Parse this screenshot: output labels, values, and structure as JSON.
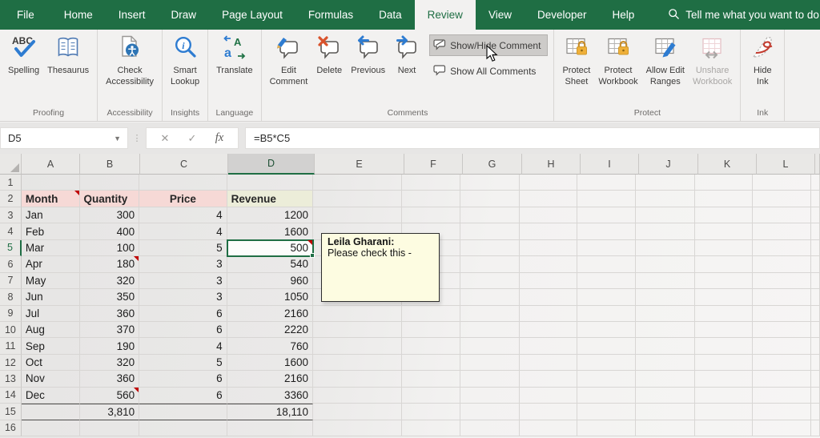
{
  "colors": {
    "excel_green": "#1f6e44",
    "selection_green": "#1f6e44",
    "note_red": "#c00000",
    "header_pink": "#f6d9d6",
    "header_green": "#ecedd9",
    "comment_bg": "#fdfce1",
    "highlight_gray": "#cdcbc9"
  },
  "app": {
    "tabs": [
      {
        "label": "File",
        "selected": false
      },
      {
        "label": "Home",
        "selected": false
      },
      {
        "label": "Insert",
        "selected": false
      },
      {
        "label": "Draw",
        "selected": false
      },
      {
        "label": "Page Layout",
        "selected": false
      },
      {
        "label": "Formulas",
        "selected": false
      },
      {
        "label": "Data",
        "selected": false
      },
      {
        "label": "Review",
        "selected": true
      },
      {
        "label": "View",
        "selected": false
      },
      {
        "label": "Developer",
        "selected": false
      },
      {
        "label": "Help",
        "selected": false
      }
    ],
    "tell_me": {
      "icon": "search-icon",
      "label": "Tell me what you want to do"
    }
  },
  "ribbon": {
    "groups": [
      {
        "label": "Proofing",
        "big": [
          {
            "name": "spelling-button",
            "icon": "spelling-icon",
            "lines": [
              "Spelling"
            ]
          },
          {
            "name": "thesaurus-button",
            "icon": "thesaurus-icon",
            "lines": [
              "Thesaurus"
            ]
          }
        ]
      },
      {
        "label": "Accessibility",
        "big": [
          {
            "name": "check-accessibility-button",
            "icon": "check-accessibility-icon",
            "lines": [
              "Check",
              "Accessibility"
            ]
          }
        ]
      },
      {
        "label": "Insights",
        "big": [
          {
            "name": "smart-lookup-button",
            "icon": "smart-lookup-icon",
            "lines": [
              "Smart",
              "Lookup"
            ]
          }
        ]
      },
      {
        "label": "Language",
        "big": [
          {
            "name": "translate-button",
            "icon": "translate-icon",
            "lines": [
              "Translate"
            ]
          }
        ]
      },
      {
        "label": "Comments",
        "big": [
          {
            "name": "edit-comment-button",
            "icon": "edit-comment-icon",
            "lines": [
              "Edit",
              "Comment"
            ]
          },
          {
            "name": "delete-comment-button",
            "icon": "delete-comment-icon",
            "lines": [
              "Delete"
            ]
          },
          {
            "name": "previous-comment-button",
            "icon": "previous-comment-icon",
            "lines": [
              "Previous"
            ]
          },
          {
            "name": "next-comment-button",
            "icon": "next-comment-icon",
            "lines": [
              "Next"
            ]
          }
        ],
        "small": [
          {
            "name": "show-hide-comment-button",
            "icon": "show-hide-comment-icon",
            "label": "Show/Hide Comment",
            "highlighted": true
          },
          {
            "name": "show-all-comments-button",
            "icon": "show-all-comments-icon",
            "label": "Show All Comments",
            "highlighted": false
          }
        ]
      },
      {
        "label": "Protect",
        "big": [
          {
            "name": "protect-sheet-button",
            "icon": "protect-sheet-icon",
            "lines": [
              "Protect",
              "Sheet"
            ]
          },
          {
            "name": "protect-workbook-button",
            "icon": "protect-workbook-icon",
            "lines": [
              "Protect",
              "Workbook"
            ]
          },
          {
            "name": "allow-edit-ranges-button",
            "icon": "allow-edit-ranges-icon",
            "lines": [
              "Allow Edit",
              "Ranges"
            ]
          },
          {
            "name": "unshare-workbook-button",
            "icon": "unshare-workbook-icon",
            "lines": [
              "Unshare",
              "Workbook"
            ],
            "disabled": true
          }
        ]
      },
      {
        "label": "Ink",
        "big": [
          {
            "name": "hide-ink-button",
            "icon": "hide-ink-icon",
            "lines": [
              "Hide",
              "Ink"
            ]
          }
        ]
      }
    ]
  },
  "formula_bar": {
    "name_box": "D5",
    "cancel_icon": "✕",
    "enter_icon": "✓",
    "fx_label": "fx",
    "formula": "=B5*C5"
  },
  "grid": {
    "column_letters": [
      "A",
      "B",
      "C",
      "D",
      "E",
      "F",
      "G",
      "H",
      "I",
      "J",
      "K",
      "L"
    ],
    "selected_column": "D",
    "selected_row": 5,
    "selected_cell": "D5",
    "note_cells": [
      "A2",
      "B6",
      "B14",
      "D5"
    ],
    "rows": [
      {
        "n": 1,
        "cells": {}
      },
      {
        "n": 2,
        "cells": {
          "A": "Month",
          "B": "Quantity",
          "C": "Price",
          "D": "Revenue"
        }
      },
      {
        "n": 3,
        "cells": {
          "A": "Jan",
          "B": "300",
          "C": "4",
          "D": "1200"
        }
      },
      {
        "n": 4,
        "cells": {
          "A": "Feb",
          "B": "400",
          "C": "4",
          "D": "1600"
        }
      },
      {
        "n": 5,
        "cells": {
          "A": "Mar",
          "B": "100",
          "C": "5",
          "D": "500"
        }
      },
      {
        "n": 6,
        "cells": {
          "A": "Apr",
          "B": "180",
          "C": "3",
          "D": "540"
        }
      },
      {
        "n": 7,
        "cells": {
          "A": "May",
          "B": "320",
          "C": "3",
          "D": "960"
        }
      },
      {
        "n": 8,
        "cells": {
          "A": "Jun",
          "B": "350",
          "C": "3",
          "D": "1050"
        }
      },
      {
        "n": 9,
        "cells": {
          "A": "Jul",
          "B": "360",
          "C": "6",
          "D": "2160"
        }
      },
      {
        "n": 10,
        "cells": {
          "A": "Aug",
          "B": "370",
          "C": "6",
          "D": "2220"
        }
      },
      {
        "n": 11,
        "cells": {
          "A": "Sep",
          "B": "190",
          "C": "4",
          "D": "760"
        }
      },
      {
        "n": 12,
        "cells": {
          "A": "Oct",
          "B": "320",
          "C": "5",
          "D": "1600"
        }
      },
      {
        "n": 13,
        "cells": {
          "A": "Nov",
          "B": "360",
          "C": "6",
          "D": "2160"
        }
      },
      {
        "n": 14,
        "cells": {
          "A": "Dec",
          "B": "560",
          "C": "6",
          "D": "3360"
        }
      },
      {
        "n": 15,
        "cells": {
          "B": "3,810",
          "D": "18,110"
        }
      },
      {
        "n": 16,
        "cells": {}
      }
    ]
  },
  "comment": {
    "author": "Leila Gharani:",
    "text": "Please check this -"
  }
}
